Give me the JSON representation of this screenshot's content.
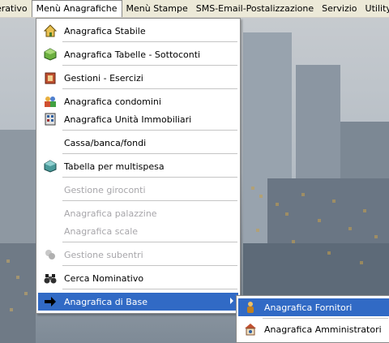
{
  "menubar": {
    "items": [
      {
        "label": "erativo"
      },
      {
        "label": "Menù Anagrafiche"
      },
      {
        "label": "Menù Stampe"
      },
      {
        "label": "SMS-Email-Postalizzazione"
      },
      {
        "label": "Servizio"
      },
      {
        "label": "Utility"
      }
    ]
  },
  "dropdown": {
    "items": [
      {
        "label": "Anagrafica Stabile",
        "icon": "home-icon",
        "enabled": true
      },
      {
        "label": "Anagrafica Tabelle - Sottoconti",
        "icon": "cube-icon",
        "enabled": true
      },
      {
        "label": "Gestioni - Esercizi",
        "icon": "ledger-icon",
        "enabled": true
      },
      {
        "label": "Anagrafica condomini",
        "icon": "people-icon",
        "enabled": true
      },
      {
        "label": "Anagrafica Unità Immobiliari",
        "icon": "building-units-icon",
        "enabled": true
      },
      {
        "label": "Cassa/banca/fondi",
        "icon": "",
        "enabled": true
      },
      {
        "label": "Tabella per multispesa",
        "icon": "cube-icon",
        "enabled": true
      },
      {
        "label": "Gestione giroconti",
        "icon": "",
        "enabled": false
      },
      {
        "label": "Anagrafica palazzine",
        "icon": "",
        "enabled": false
      },
      {
        "label": "Anagrafica scale",
        "icon": "",
        "enabled": false
      },
      {
        "label": "Gestione subentri",
        "icon": "swap-icon",
        "enabled": false
      },
      {
        "label": "Cerca Nominativo",
        "icon": "binoculars-icon",
        "enabled": true
      },
      {
        "label": "Anagrafica di Base",
        "icon": "arrow-right-icon",
        "enabled": true,
        "submenu": true
      }
    ]
  },
  "submenu": {
    "items": [
      {
        "label": "Anagrafica Fornitori",
        "icon": "person-icon"
      },
      {
        "label": "Anagrafica Amministratori",
        "icon": "admin-icon"
      }
    ]
  },
  "colors": {
    "menubar": "#ece9d8",
    "highlight": "#316ac5",
    "disabled_text": "#a7a6aa"
  }
}
